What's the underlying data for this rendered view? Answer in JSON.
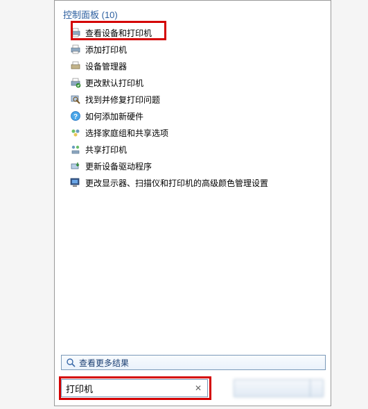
{
  "category": {
    "label": "控制面板 (10)"
  },
  "results": [
    {
      "label": "查看设备和打印机",
      "icon": "printer-devices-icon"
    },
    {
      "label": "添加打印机",
      "icon": "printer-add-icon"
    },
    {
      "label": "设备管理器",
      "icon": "device-manager-icon"
    },
    {
      "label": "更改默认打印机",
      "icon": "printer-default-icon"
    },
    {
      "label": "找到并修复打印问题",
      "icon": "troubleshoot-icon"
    },
    {
      "label": "如何添加新硬件",
      "icon": "help-icon"
    },
    {
      "label": "选择家庭组和共享选项",
      "icon": "homegroup-icon"
    },
    {
      "label": "共享打印机",
      "icon": "share-printer-icon"
    },
    {
      "label": "更新设备驱动程序",
      "icon": "update-driver-icon"
    },
    {
      "label": "更改显示器、扫描仪和打印机的高级颜色管理设置",
      "icon": "color-management-icon"
    }
  ],
  "seeMore": {
    "label": "查看更多结果"
  },
  "search": {
    "value": "打印机"
  },
  "colors": {
    "highlight": "#d40000",
    "link": "#2a5d9e"
  }
}
